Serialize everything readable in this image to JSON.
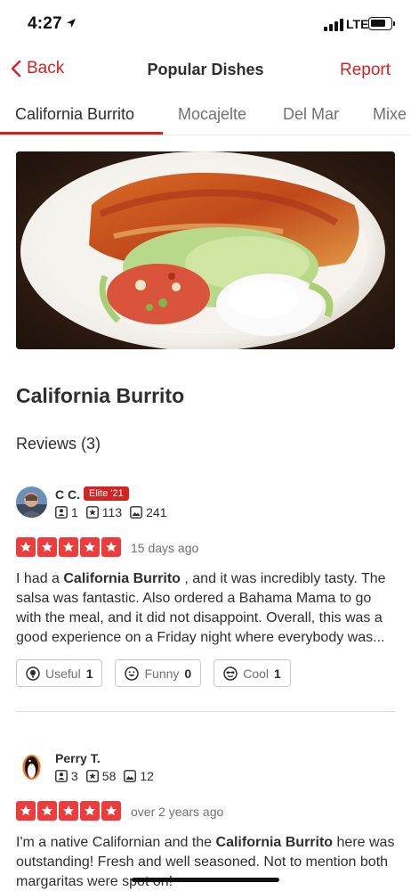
{
  "status": {
    "time": "4:27",
    "network": "LTE"
  },
  "nav": {
    "back_label": "Back",
    "title": "Popular Dishes",
    "report_label": "Report"
  },
  "tabs": [
    {
      "label": "California Burrito"
    },
    {
      "label": "Mocajelte"
    },
    {
      "label": "Del Mar"
    },
    {
      "label": "Mixe"
    }
  ],
  "dish": {
    "title": "California Burrito"
  },
  "reviews_heading": "Reviews (3)",
  "reviews": [
    {
      "name": "C C.",
      "badge": "Elite '21",
      "friends": "1",
      "review_count": "113",
      "photos": "241",
      "rating": 5,
      "date": "15 days ago",
      "text_before": "I had a ",
      "text_bold": "California Burrito",
      "text_after": " , and it was incredibly tasty. The salsa was fantastic. Also ordered a Bahama Mama to go with the meal, and it did not disappoint. Overall, this was a good experience on a Friday night where everybody was...",
      "actions": [
        {
          "label": "Useful",
          "count": "1"
        },
        {
          "label": "Funny",
          "count": "0"
        },
        {
          "label": "Cool",
          "count": "1"
        }
      ]
    },
    {
      "name": "Perry T.",
      "friends": "3",
      "review_count": "58",
      "photos": "12",
      "rating": 5,
      "date": "over 2 years ago",
      "text_before": "I'm a native Californian and the ",
      "text_bold": "California Burrito",
      "text_after": " here was outstanding! Fresh and well seasoned. Not to mention both margaritas were spot on!"
    }
  ],
  "colors": {
    "accent": "#d32323",
    "star": "#ee3c3c"
  }
}
